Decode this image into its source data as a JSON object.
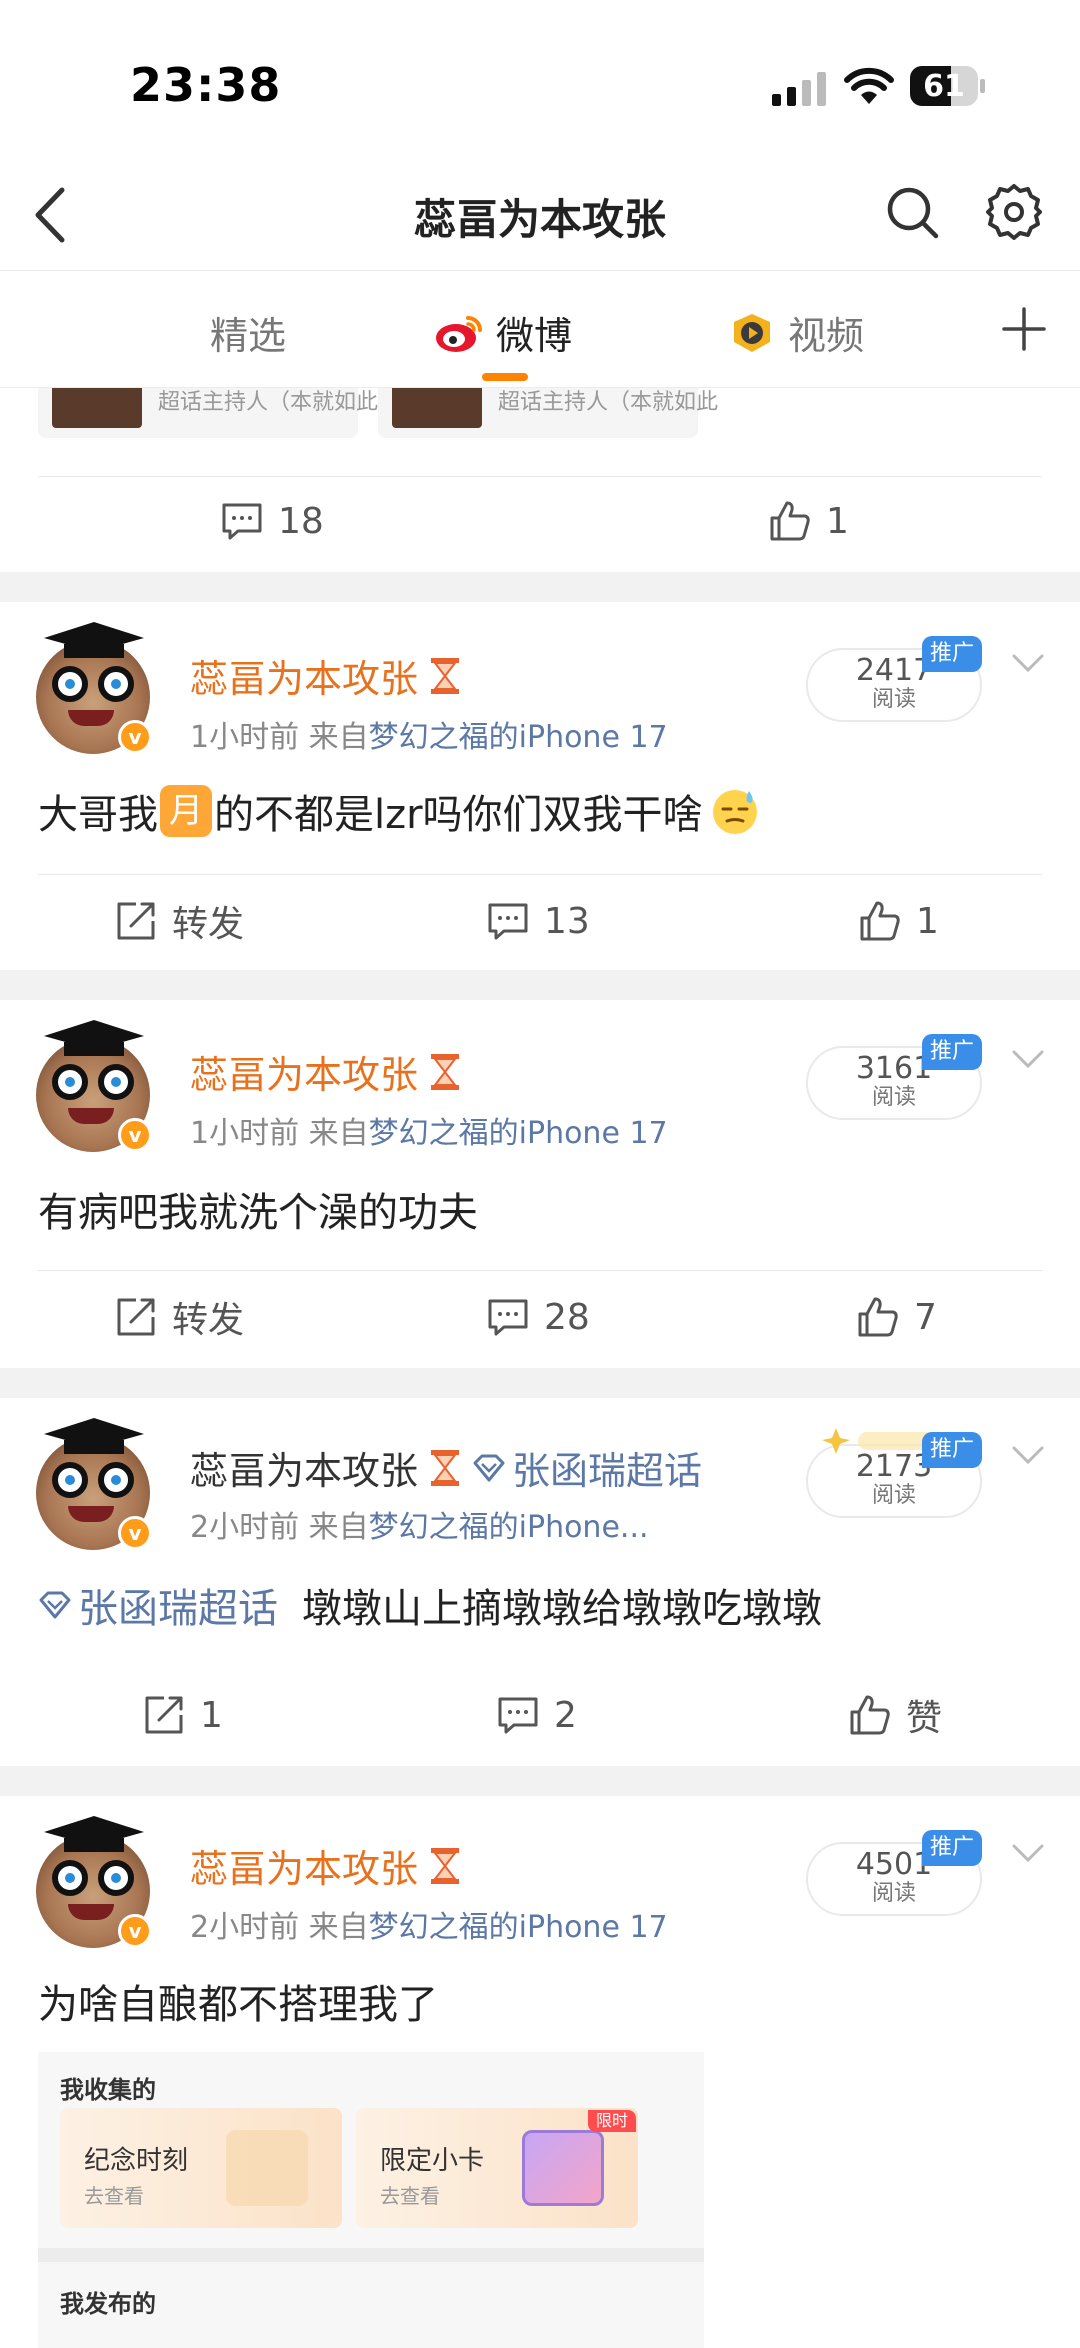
{
  "status_bar": {
    "time": "23:38",
    "battery": "61",
    "battery_level": 0.61
  },
  "nav": {
    "title": "蕊畐为本攻张"
  },
  "tabs": [
    {
      "label": "精选",
      "active": false
    },
    {
      "label": "微博",
      "active": true
    },
    {
      "label": "视频",
      "active": false
    }
  ],
  "top_remnant": {
    "card_text_1": "超话主持人（本就如此萌",
    "card_text_2": "超话主持人（本就如此",
    "comments": "18",
    "likes": "1"
  },
  "posts": [
    {
      "username": "蕊畐为本攻张",
      "time": "1小时前",
      "from_prefix": "来自",
      "source": "梦幻之福的iPhone 17",
      "views": "2417",
      "views_label": "阅读",
      "promo": "推广",
      "text_before": "大哥我",
      "moon": "月",
      "text_after": "的不都是lzr吗你们双我干啥",
      "repost": "转发",
      "comments": "13",
      "likes": "1"
    },
    {
      "username": "蕊畐为本攻张",
      "time": "1小时前",
      "from_prefix": "来自",
      "source": "梦幻之福的iPhone 17",
      "views": "3161",
      "views_label": "阅读",
      "promo": "推广",
      "text": "有病吧我就洗个澡的功夫",
      "repost": "转发",
      "comments": "28",
      "likes": "7"
    },
    {
      "username": "蕊畐为本攻张",
      "super_topic": "张函瑞超话",
      "time": "2小时前",
      "from_prefix": "来自",
      "source": "梦幻之福的iPhone...",
      "views": "2173",
      "views_label": "阅读",
      "promo": "推广",
      "topic_link": "张函瑞超话",
      "text": "墩墩山上摘墩墩给墩墩吃墩墩",
      "reposts": "1",
      "comments": "2",
      "likes": "赞"
    },
    {
      "username": "蕊畐为本攻张",
      "time": "2小时前",
      "from_prefix": "来自",
      "source": "梦幻之福的iPhone 17",
      "views": "4501",
      "views_label": "阅读",
      "promo": "推广",
      "text": "为啥自酿都不搭理我了",
      "collect_label": "我收集的",
      "card1_title": "纪念时刻",
      "card1_sub": "去查看",
      "card2_title": "限定小卡",
      "card2_sub": "去查看",
      "card2_badge": "限时",
      "published_label": "我发布的"
    }
  ],
  "colors": {
    "accent": "#ff8200",
    "username": "#e8711d",
    "link": "#5b78a6",
    "promo": "#3b8ee8"
  }
}
